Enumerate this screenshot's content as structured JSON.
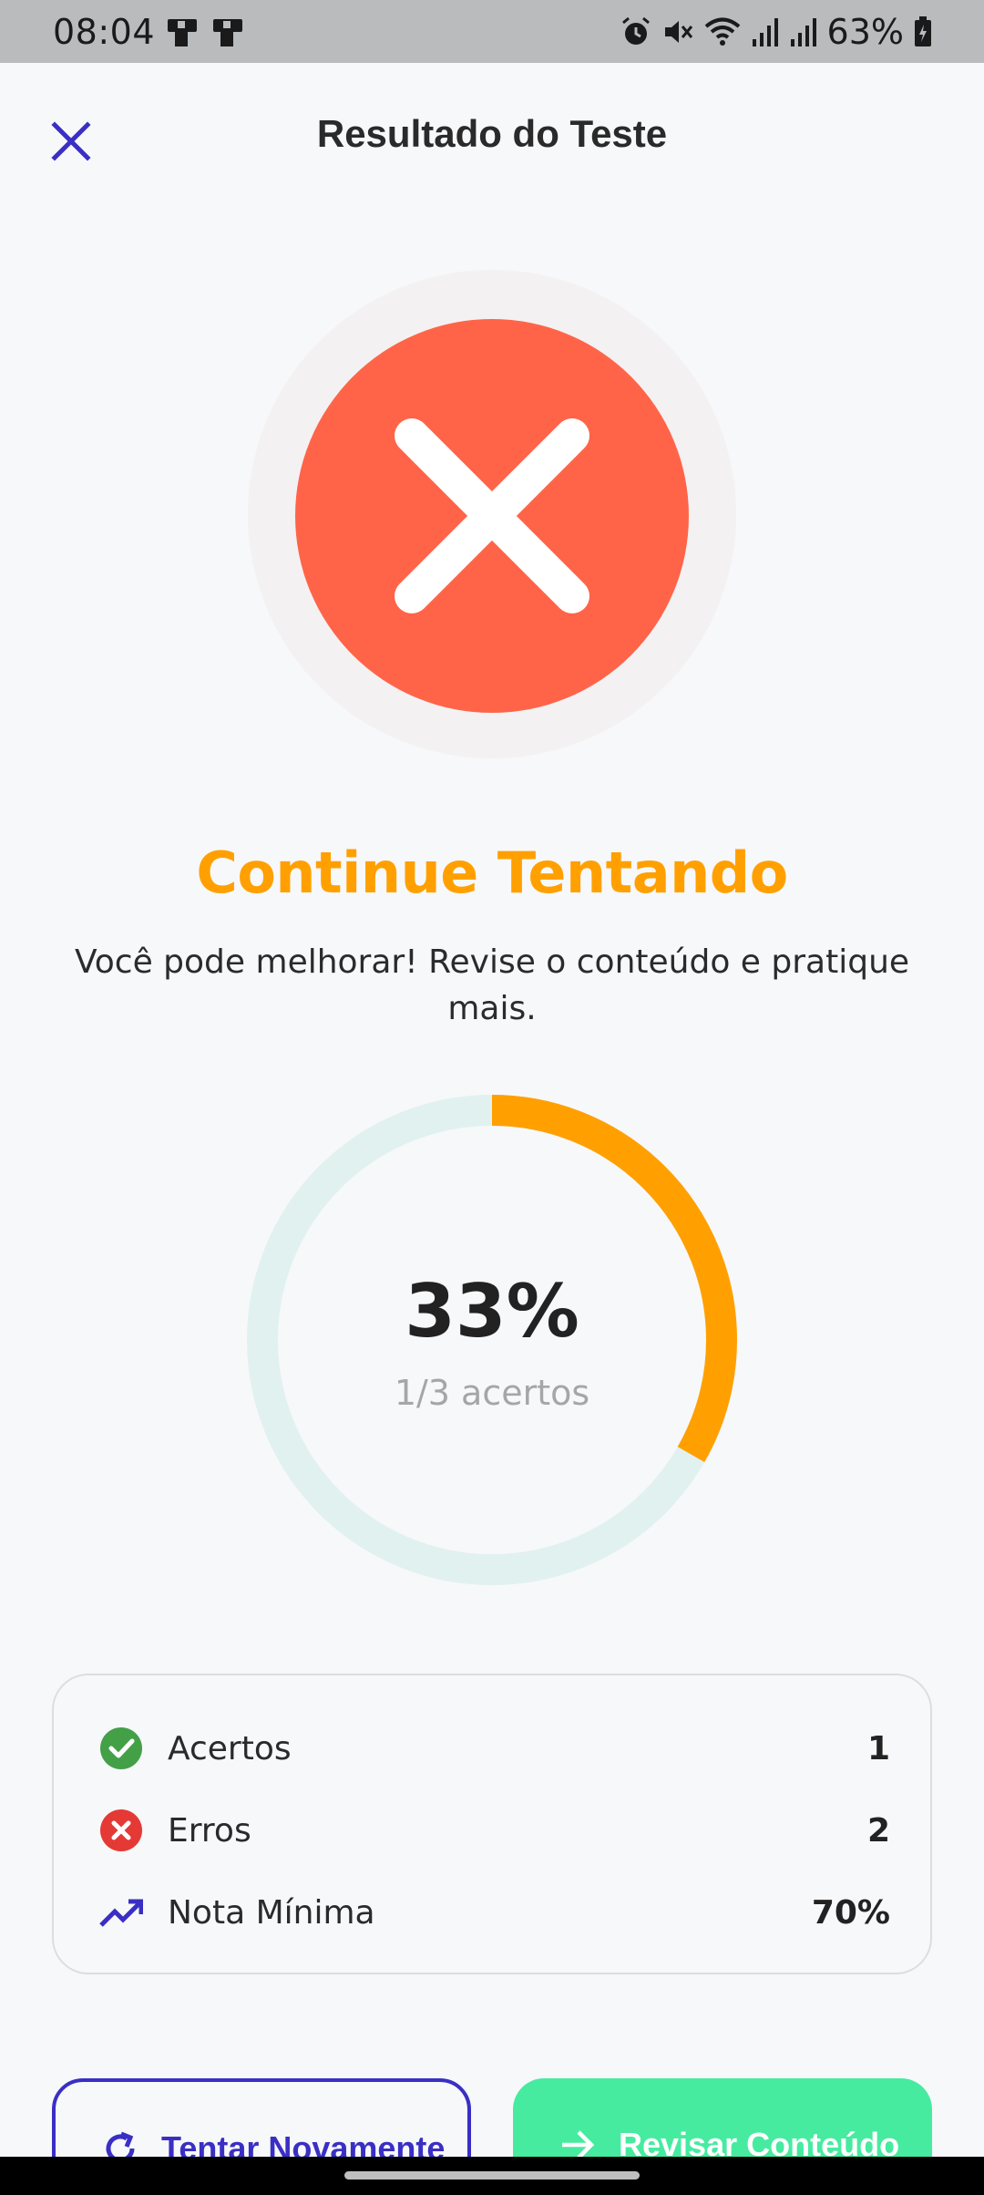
{
  "status_bar": {
    "time": "08:04",
    "battery_percent": "63%",
    "icons": [
      "sim-icon",
      "sim-icon",
      "alarm-icon",
      "mute-icon",
      "wifi-icon",
      "signal-icon",
      "signal-icon",
      "battery-icon"
    ]
  },
  "header": {
    "title": "Resultado do Teste",
    "close_icon": "close-icon"
  },
  "result": {
    "status_icon": "close-icon",
    "headline": "Continue Tentando",
    "message": "Você pode melhorar! Revise o conteúdo e pratique mais."
  },
  "progress": {
    "percent_text": "33%",
    "fraction": 0.333,
    "detail": "1/3 acertos",
    "ring_color": "#ffa000",
    "track_color": "#e1f1ef"
  },
  "stats": [
    {
      "icon": "check-circle-icon",
      "label": "Acertos",
      "value": "1",
      "color": "#43a047"
    },
    {
      "icon": "error-circle-icon",
      "label": "Erros",
      "value": "2",
      "color": "#e53935"
    },
    {
      "icon": "trending-up-icon",
      "label": "Nota Mínima",
      "value": "70%",
      "color": "#3a2fc4"
    }
  ],
  "actions": {
    "retry": {
      "label": "Tentar Novamente",
      "icon": "refresh-icon"
    },
    "review": {
      "label": "Revisar Conteúdo",
      "icon": "arrow-right-icon"
    }
  },
  "colors": {
    "accent": "#3a2fc4",
    "error": "#ff6449",
    "warning": "#ffa000",
    "success_button": "#47eba0"
  }
}
